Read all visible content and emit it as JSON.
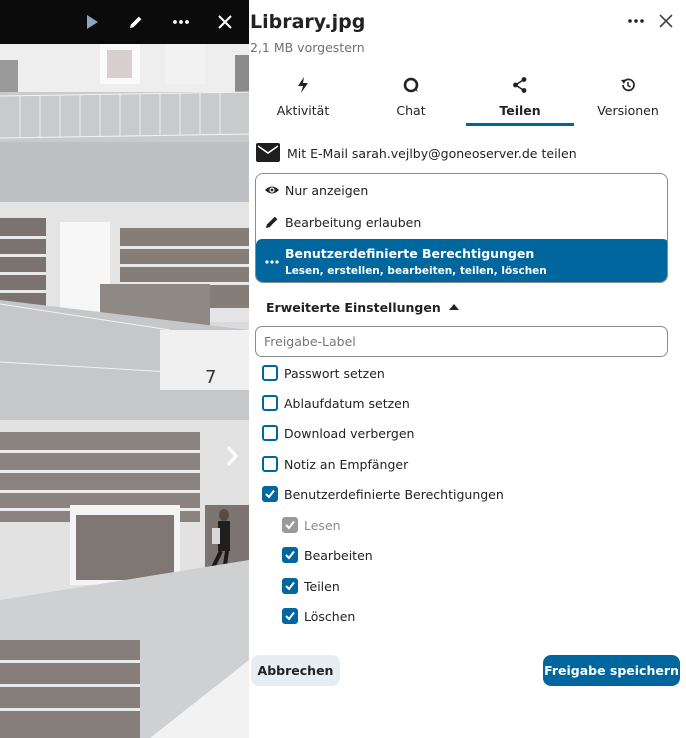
{
  "file": {
    "name": "Library.jpg",
    "meta": "2,1 MB vorgestern"
  },
  "viewer": {
    "icons": [
      "play-icon",
      "pencil-icon",
      "more-icon",
      "close-icon",
      "chevron-right-icon"
    ]
  },
  "tabs": [
    {
      "label": "Aktivität",
      "icon": "flash-icon"
    },
    {
      "label": "Chat",
      "icon": "chat-icon"
    },
    {
      "label": "Teilen",
      "icon": "share-icon",
      "active": true
    },
    {
      "label": "Versionen",
      "icon": "history-icon"
    }
  ],
  "share": {
    "recipient_text": "Mit E-Mail sarah.vejlby@goneoserver.de teilen",
    "permissions": [
      {
        "label": "Nur anzeigen",
        "icon": "eye-icon"
      },
      {
        "label": "Bearbeitung erlauben",
        "icon": "pencil-icon"
      },
      {
        "label": "Benutzerdefinierte Berechtigungen",
        "sub": "Lesen, erstellen, bearbeiten, teilen, löschen",
        "icon": "dots-icon",
        "selected": true
      }
    ],
    "advanced_label": "Erweiterte Einstellungen",
    "label_placeholder": "Freigabe-Label",
    "label_value": "",
    "options": [
      {
        "label": "Passwort setzen",
        "checked": false
      },
      {
        "label": "Ablaufdatum setzen",
        "checked": false
      },
      {
        "label": "Download verbergen",
        "checked": false
      },
      {
        "label": "Notiz an Empfänger",
        "checked": false
      },
      {
        "label": "Benutzerdefinierte Berechtigungen",
        "checked": true
      }
    ],
    "custom_permissions": [
      {
        "label": "Lesen",
        "checked": true,
        "disabled": true
      },
      {
        "label": "Bearbeiten",
        "checked": true,
        "disabled": false
      },
      {
        "label": "Teilen",
        "checked": true,
        "disabled": false
      },
      {
        "label": "Löschen",
        "checked": true,
        "disabled": false
      }
    ],
    "cancel_label": "Abbrechen",
    "save_label": "Freigabe speichern"
  },
  "colors": {
    "accent": "#00679e",
    "viewer_bar": "#0b0b0b",
    "cancel_bg": "#e6edf3"
  }
}
